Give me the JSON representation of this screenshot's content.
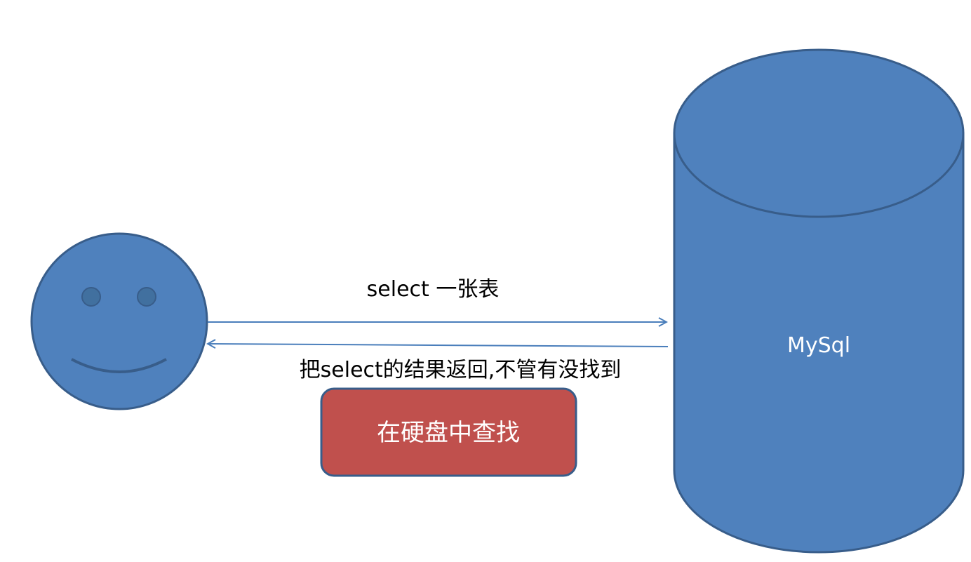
{
  "diagram": {
    "request_label": "select 一张表",
    "response_label": "把select的结果返回,不管有没找到",
    "process_box_label": "在硬盘中查找",
    "database_label": "MySql"
  },
  "colors": {
    "shape_fill": "#4f81bd",
    "shape_stroke": "#385d8a",
    "process_fill": "#c0504d",
    "arrow": "#4a7ebb",
    "background": "#ffffff"
  },
  "icons": {
    "user": "smiley-face-icon",
    "database": "cylinder-database-icon"
  }
}
